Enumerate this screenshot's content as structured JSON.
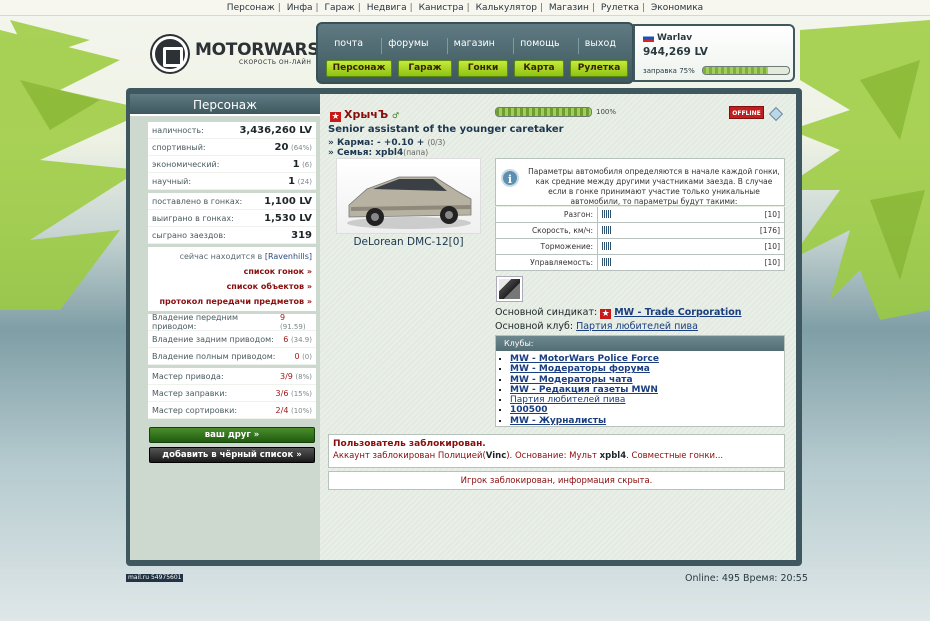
{
  "topnav": [
    "Персонаж",
    "Инфа",
    "Гараж",
    "Недвига",
    "Канистра",
    "Калькулятор",
    "Магазин",
    "Рулетка",
    "Экономика"
  ],
  "logo": {
    "brand": "MOTORWARS.RU",
    "slogan": "СКОРОСТЬ ОН-ЛАЙН"
  },
  "menu": {
    "top": [
      "почта",
      "форумы",
      "магазин",
      "помощь",
      "выход"
    ],
    "bottom": [
      "Персонаж",
      "Гараж",
      "Гонки",
      "Карта",
      "Рулетка"
    ]
  },
  "user": {
    "name": "Warlav",
    "money": "944,269 LV",
    "fuel_label": "заправка 75%",
    "fuel_fraction": 0.75
  },
  "left": {
    "title": "Персонаж",
    "stats": [
      {
        "label": "наличность:",
        "value": "3,436,260 LV",
        "extra": ""
      },
      {
        "label": "спортивный:",
        "value": "20",
        "extra": "(64%)"
      },
      {
        "label": "экономический:",
        "value": "1",
        "extra": "(6)"
      },
      {
        "label": "научный:",
        "value": "1",
        "extra": "(24)"
      }
    ],
    "races": [
      {
        "label": "поставлено в гонках:",
        "value": "1,100 LV"
      },
      {
        "label": "выиграно в гонках:",
        "value": "1,530 LV"
      },
      {
        "label": "сыграно заездов:",
        "value": "319"
      }
    ],
    "location_prefix": "сейчас находится в",
    "location": "[Ravenhills]",
    "links": [
      "список гонок »",
      "список объектов »",
      "протокол передачи предметов »"
    ],
    "drive": [
      {
        "label": "Владение передним приводом:",
        "value": "9",
        "extra": "(91.59)"
      },
      {
        "label": "Владение задним приводом:",
        "value": "6",
        "extra": "(34.9)"
      },
      {
        "label": "Владение полным приводом:",
        "value": "0",
        "extra": "(0)"
      }
    ],
    "master": [
      {
        "label": "Мастер привода:",
        "value": "3/9",
        "extra": "(8%)"
      },
      {
        "label": "Мастер заправки:",
        "value": "3/6",
        "extra": "(15%)"
      },
      {
        "label": "Мастер сортировки:",
        "value": "2/4",
        "extra": "(10%)"
      }
    ],
    "btn_friend": "ваш друг »",
    "btn_black": "добавить в чёрный список »"
  },
  "profile": {
    "nick": "ХрычЪ",
    "rank": "Senior assistant of the younger caretaker",
    "karma_label": "» Карма:",
    "karma_value": "- +0.10 +",
    "karma_extra": "(0/3)",
    "family_label": "» Семья:",
    "family_value": "xpbl4",
    "family_extra": "(папа)",
    "hp_fraction": 1.0,
    "hp_label": "100%",
    "status": "OFFLINE",
    "car_name": "DeLorean DMC-12[0]",
    "info": "Параметры автомобиля определяются в начале каждой гонки, как средние между другими участниками заезда. В случае если в гонке принимают участие только уникальные автомобили, то параметры будут такими:",
    "params": [
      {
        "label": "Разгон:",
        "value": "[10]"
      },
      {
        "label": "Скорость, км/ч:",
        "value": "[176]"
      },
      {
        "label": "Торможение:",
        "value": "[10]"
      },
      {
        "label": "Управляемость:",
        "value": "[10]"
      }
    ],
    "syndicate_label": "Основной синдикат:",
    "syndicate": "MW - Trade Corporation",
    "club_label": "Основной клуб:",
    "club": "Партия любителей пива",
    "clubs_title": "Клубы:",
    "clubs": [
      "MW - MotorWars Police Force",
      "MW - Модераторы форума",
      "MW - Модераторы чата",
      "MW - Редакция газеты MWN",
      "Партия любителей пива",
      "100500",
      "MW - Журналисты"
    ],
    "blocked_title": "Пользователь заблокирован.",
    "blocked_text1": "Аккаунт заблокирован Полицией(",
    "blocked_by": "Vinc",
    "blocked_text2": "). Основание: Мульт",
    "blocked_nick": "xpbl4",
    "blocked_text3": ". Совместные гонки...",
    "hidden_info": "Игрок заблокирован, информация скрыта."
  },
  "footer": {
    "badge": "mail.ru 54975601",
    "online": "Online: 495 Время: 20:55"
  }
}
